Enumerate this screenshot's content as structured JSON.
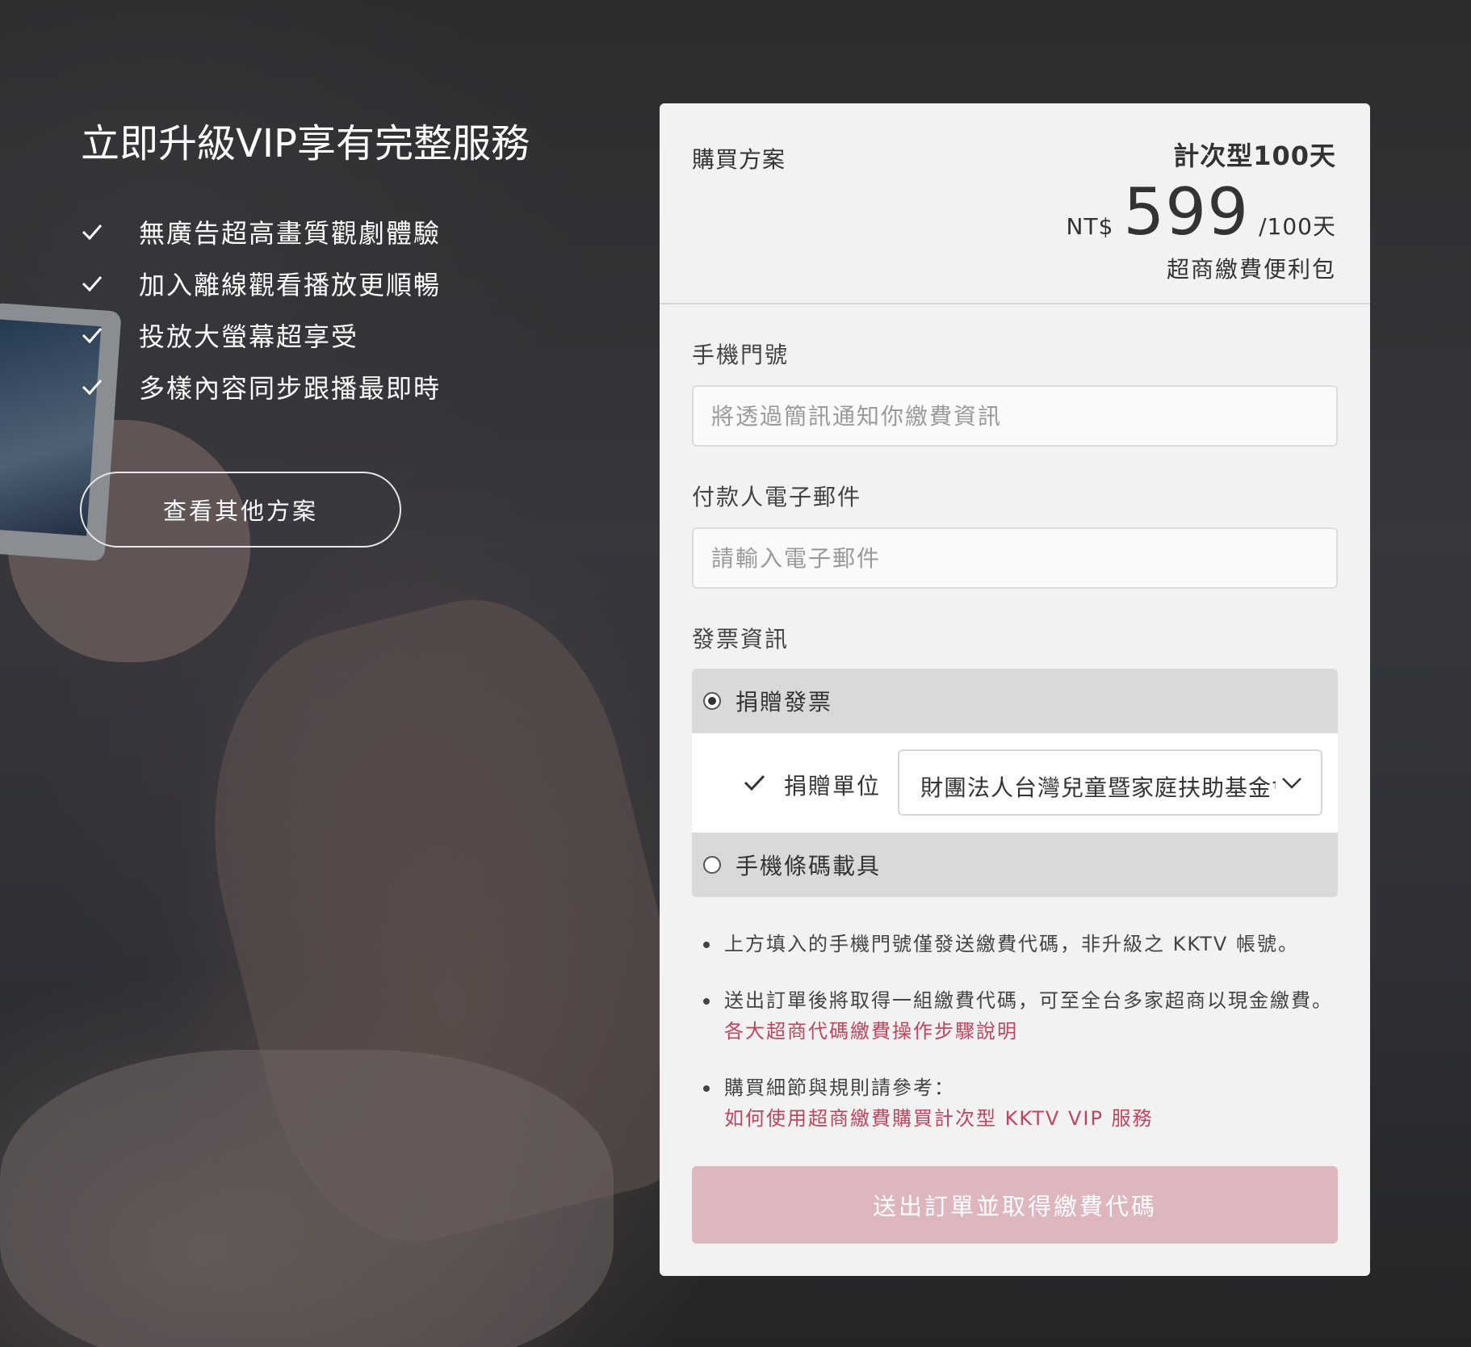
{
  "promo": {
    "headline": "立即升級VIP享有完整服務",
    "features": [
      "無廣告超高畫質觀劇體驗",
      "加入離線觀看播放更順暢",
      "投放大螢幕超享受",
      "多樣內容同步跟播最即時"
    ],
    "other_plans_button": "查看其他方案"
  },
  "plan": {
    "label": "購買方案",
    "name": "計次型100天",
    "currency": "NT$",
    "amount": "599",
    "period": "/100天",
    "subtitle": "超商繳費便利包"
  },
  "form": {
    "phone": {
      "label": "手機門號",
      "value": "",
      "placeholder": "將透過簡訊通知你繳費資訊"
    },
    "email": {
      "label": "付款人電子郵件",
      "value": "",
      "placeholder": "請輸入電子郵件"
    },
    "invoice": {
      "label": "發票資訊",
      "options": [
        {
          "label": "捐贈發票",
          "selected": true
        },
        {
          "label": "手機條碼載具",
          "selected": false
        }
      ],
      "donate_label": "捐贈單位",
      "donate_selected": "財團法人台灣兒童暨家庭扶助基金會"
    }
  },
  "notes": [
    {
      "text": "上方填入的手機門號僅發送繳費代碼，非升級之 KKTV 帳號。",
      "link": ""
    },
    {
      "text": "送出訂單後將取得一組繳費代碼，可至全台多家超商以現金繳費。",
      "link": "各大超商代碼繳費操作步驟說明"
    },
    {
      "text": "購買細節與規則請參考：",
      "link": "如何使用超商繳費購買計次型 KKTV VIP 服務"
    }
  ],
  "submit_label": "送出訂單並取得繳費代碼",
  "colors": {
    "accent_link": "#c0455f",
    "submit_bg": "#ddb6be",
    "card_bg": "#f2f2f2"
  }
}
